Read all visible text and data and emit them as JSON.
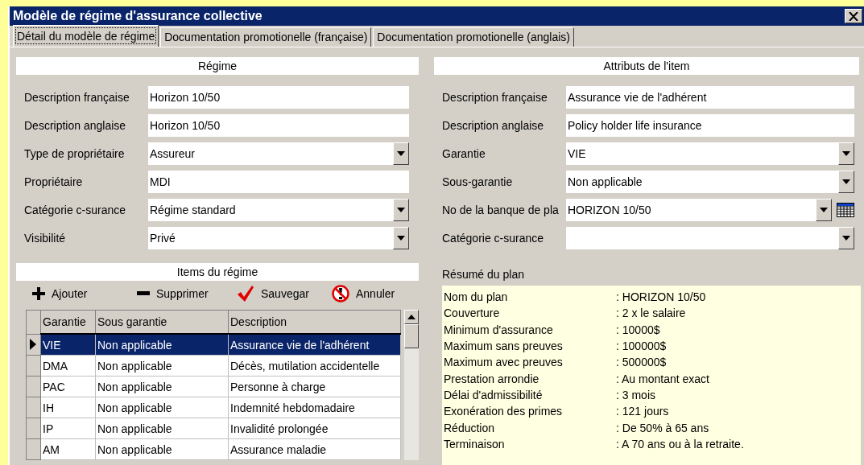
{
  "window": {
    "title": "Modèle de régime d'assurance collective"
  },
  "tabs": [
    {
      "label": "Détail du modèle de régime",
      "selected": true
    },
    {
      "label": "Documentation promotionelle (française)",
      "selected": false
    },
    {
      "label": "Documentation promotionelle (anglais)",
      "selected": false
    }
  ],
  "regime": {
    "header": "Régime",
    "fields": [
      {
        "label": "Description française",
        "value": "Horizon 10/50",
        "kind": "text"
      },
      {
        "label": "Description anglaise",
        "value": "Horizon 10/50",
        "kind": "text"
      },
      {
        "label": "Type de propriétaire",
        "value": "Assureur",
        "kind": "dropdown"
      },
      {
        "label": "Propriétaire",
        "value": "MDI",
        "kind": "text"
      },
      {
        "label": "Catégorie c-surance",
        "value": "Régime standard",
        "kind": "dropdown"
      },
      {
        "label": "Visibilité",
        "value": "Privé",
        "kind": "dropdown"
      }
    ]
  },
  "item_attributes": {
    "header": "Attributs de l'item",
    "fields": [
      {
        "label": "Description française",
        "value": "Assurance vie de l'adhérent",
        "kind": "text"
      },
      {
        "label": "Description anglaise",
        "value": "Policy holder life insurance",
        "kind": "text"
      },
      {
        "label": "Garantie",
        "value": "VIE",
        "kind": "dropdown"
      },
      {
        "label": "Sous-garantie",
        "value": "Non applicable",
        "kind": "dropdown"
      },
      {
        "label": "No de la banque de pla",
        "value": "HORIZON 10/50",
        "kind": "dropdown-calendar"
      },
      {
        "label": "Catégorie c-surance",
        "kind": "dropdown"
      }
    ]
  },
  "items": {
    "header": "Items du régime",
    "toolbar": [
      {
        "label": "Ajouter",
        "kind": "add"
      },
      {
        "label": "Supprimer",
        "kind": "delete"
      },
      {
        "label": "Sauvegar",
        "kind": "save"
      },
      {
        "label": "Annuler",
        "kind": "cancel"
      }
    ],
    "table": {
      "columns": [
        "Garantie",
        "Sous garantie",
        "Description"
      ],
      "rows": [
        {
          "cells": [
            "VIE",
            "Non applicable",
            "Assurance vie de l'adhérent"
          ],
          "selected": true
        },
        {
          "cells": [
            "DMA",
            "Non applicable",
            "Décès, mutilation accidentelle"
          ],
          "selected": false
        },
        {
          "cells": [
            "PAC",
            "Non applicable",
            "Personne à charge"
          ],
          "selected": false
        },
        {
          "cells": [
            "IH",
            "Non applicable",
            "Indemnité hebdomadaire"
          ],
          "selected": false
        },
        {
          "cells": [
            "IP",
            "Non applicable",
            "Invalidité prolongée"
          ],
          "selected": false
        },
        {
          "cells": [
            "AM",
            "Non applicable",
            "Assurance maladie"
          ],
          "selected": false
        }
      ]
    }
  },
  "plan_summary": {
    "title": "Résumé du plan",
    "lines": [
      {
        "label": "Nom du plan",
        "value": ": HORIZON 10/50"
      },
      {
        "label": "Couverture",
        "value": ": 2 x le salaire"
      },
      {
        "label": "Minimum d'assurance",
        "value": ": 10000$"
      },
      {
        "label": "Maximum sans preuves",
        "value": ": 100000$"
      },
      {
        "label": "Maximum avec preuves",
        "value": ": 500000$"
      },
      {
        "label": "Prestation arrondie",
        "value": ": Au montant exact"
      },
      {
        "label": "Délai d'admissibilité",
        "value": ": 3 mois"
      },
      {
        "label": "Exonération des primes",
        "value": ": 121 jours"
      },
      {
        "label": "Réduction",
        "value": ": De 50% à 65 ans"
      },
      {
        "label": "Terminaison",
        "value": ": A 70 ans ou à la retraite."
      }
    ]
  }
}
